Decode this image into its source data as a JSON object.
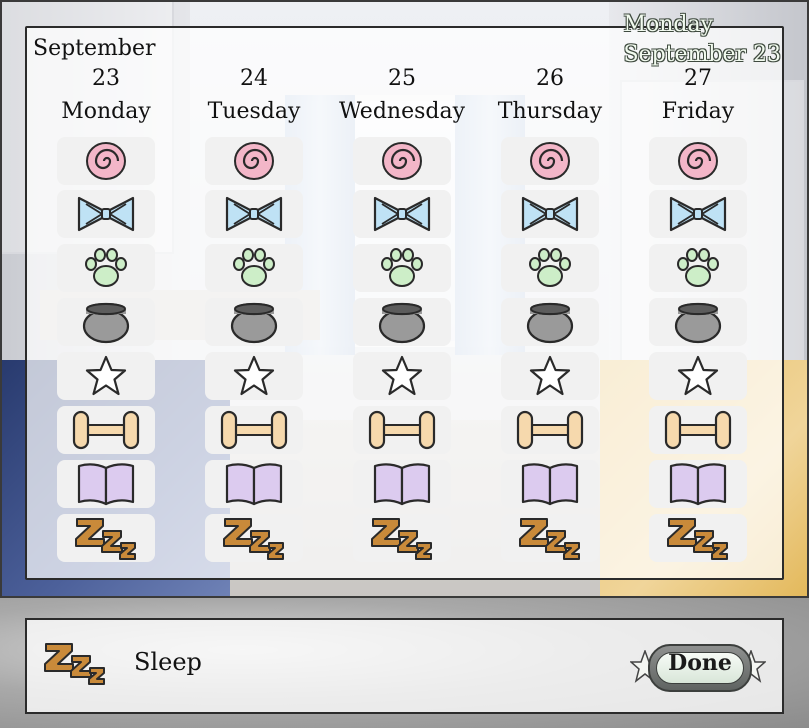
{
  "current_date": {
    "weekday": "Monday",
    "date": "September 23"
  },
  "month": "September",
  "days": [
    {
      "num": "23",
      "name": "Monday"
    },
    {
      "num": "24",
      "name": "Tuesday"
    },
    {
      "num": "25",
      "name": "Wednesday"
    },
    {
      "num": "26",
      "name": "Thursday"
    },
    {
      "num": "27",
      "name": "Friday"
    }
  ],
  "activity_icons": [
    "swirl-icon",
    "bow-icon",
    "paw-icon",
    "cauldron-icon",
    "star-icon",
    "dumbbell-icon",
    "book-icon",
    "sleep-icon"
  ],
  "selected": {
    "icon": "sleep-icon",
    "label": "Sleep"
  },
  "done_label": "Done",
  "colors": {
    "swirl": "#f3b6c8",
    "bow": "#bfe2f5",
    "paw": "#cdeec8",
    "cauldron": "#9a9a9a",
    "star": "#ffffff",
    "dumbbell": "#f6d9ad",
    "book": "#dccbef",
    "sleep": "#c98a3a"
  }
}
